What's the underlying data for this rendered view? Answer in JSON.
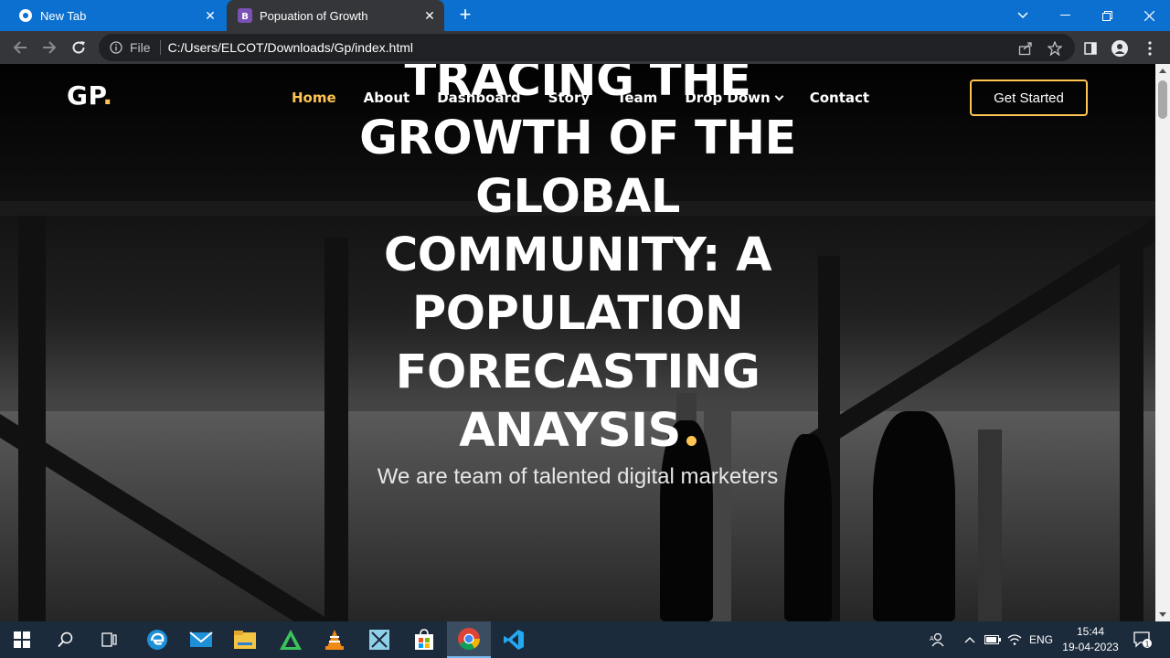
{
  "browser": {
    "tabs": [
      {
        "title": "New Tab",
        "icon": "chrome-icon"
      },
      {
        "title": "Popuation of Growth",
        "icon": "bootstrap-icon"
      }
    ],
    "scheme_label": "File",
    "url": "C:/Users/ELCOT/Downloads/Gp/index.html"
  },
  "page": {
    "brand": "GP",
    "brand_dot": ".",
    "menu": [
      "Home",
      "About",
      "Dashboard",
      "Story",
      "Team",
      "Drop Down",
      "Contact"
    ],
    "active_menu": "Home",
    "cta_label": "Get Started",
    "headline": "TRACING THE GROWTH OF THE GLOBAL COMMUNITY: A POPULATION FORECASTING ANAYSIS",
    "subtitle": "We are team of talented digital marketers",
    "accent_color": "#ffc451"
  },
  "taskbar": {
    "lang": "ENG",
    "time": "15:44",
    "date": "19-04-2023",
    "notification_count": "1"
  }
}
